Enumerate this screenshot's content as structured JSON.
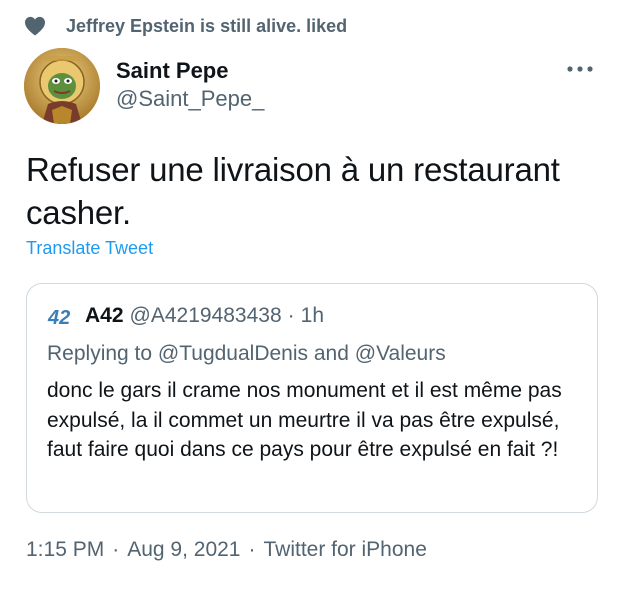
{
  "social_context": {
    "icon": "heart-icon",
    "text": "Jeffrey Epstein is still alive. liked"
  },
  "author": {
    "display_name": "Saint Pepe",
    "handle": "@Saint_Pepe_",
    "avatar_icon": "saint-pepe-avatar"
  },
  "tweet": {
    "text": "Refuser une livraison à un restaurant casher.",
    "translate_label": "Translate Tweet"
  },
  "quote": {
    "avatar_icon": "a42-logo",
    "name": "A42",
    "handle": "@A4219483438",
    "separator": "·",
    "time": "1h",
    "replying_prefix": "Replying to",
    "replying_mention_1": "@TugdualDenis",
    "replying_and": "and",
    "replying_mention_2": "@Valeurs",
    "text": "donc le gars il crame nos monument et il est même pas expulsé, la il commet un meurtre il va pas être expulsé, faut faire quoi dans ce pays pour être expulsé en fait ?!"
  },
  "meta": {
    "time": "1:15 PM",
    "separator_1": "·",
    "date": "Aug 9, 2021",
    "separator_2": "·",
    "source": "Twitter for iPhone"
  },
  "colors": {
    "text_primary": "#0f1419",
    "text_secondary": "#536471",
    "link": "#1d9bf0",
    "border": "#cfd9de"
  }
}
